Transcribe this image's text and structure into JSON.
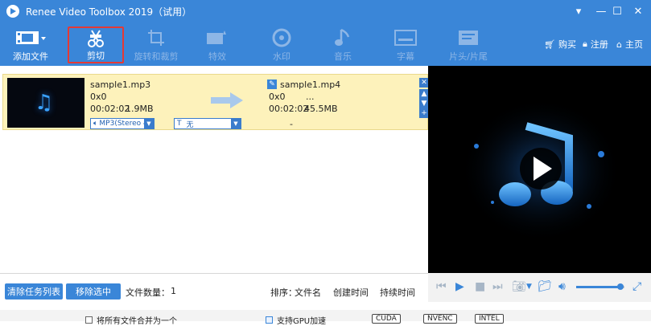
{
  "app": {
    "title": "Renee Video Toolbox 2019（试用）"
  },
  "window_controls": {
    "menu": "▾",
    "minimize": "—",
    "maximize": "☐",
    "close": "✕"
  },
  "toolbar": {
    "add_file": "添加文件",
    "cut": "剪切",
    "rotate_crop": "旋转和裁剪",
    "effects": "特效",
    "watermark": "水印",
    "music": "音乐",
    "subtitle": "字幕",
    "head_tail": "片头/片尾",
    "buy": "购买",
    "register": "注册",
    "home": "主页"
  },
  "file_item": {
    "src_name": "sample1.mp3",
    "src_res": "0x0",
    "src_duration": "00:02:02",
    "src_size": "1.9MB",
    "dst_name": "sample1.mp4",
    "dst_res": "0x0",
    "dst_extra": "...",
    "dst_duration": "00:02:02",
    "dst_size": "45.5MB",
    "audio_track": "MP3(Stereo 4",
    "subtitle_track": "无",
    "dash": "-"
  },
  "bottom": {
    "clear_list": "清除任务列表",
    "remove_selected": "移除选中",
    "file_count_label": "文件数量：",
    "file_count": "1",
    "sort_label": "排序：",
    "sort_name": "文件名",
    "sort_created": "创建时间",
    "sort_duration": "持续时间"
  },
  "player": {
    "volume": 0.92
  },
  "footer": {
    "merge": "将所有文件合并为一个",
    "gpu": "支持GPU加速",
    "cuda": "CUDA",
    "nvenc": "NVENC",
    "intel": "INTEL"
  },
  "colors": {
    "accent": "#3a86d8",
    "selected_item": "#fdf2bb",
    "highlight": "#e53935"
  }
}
